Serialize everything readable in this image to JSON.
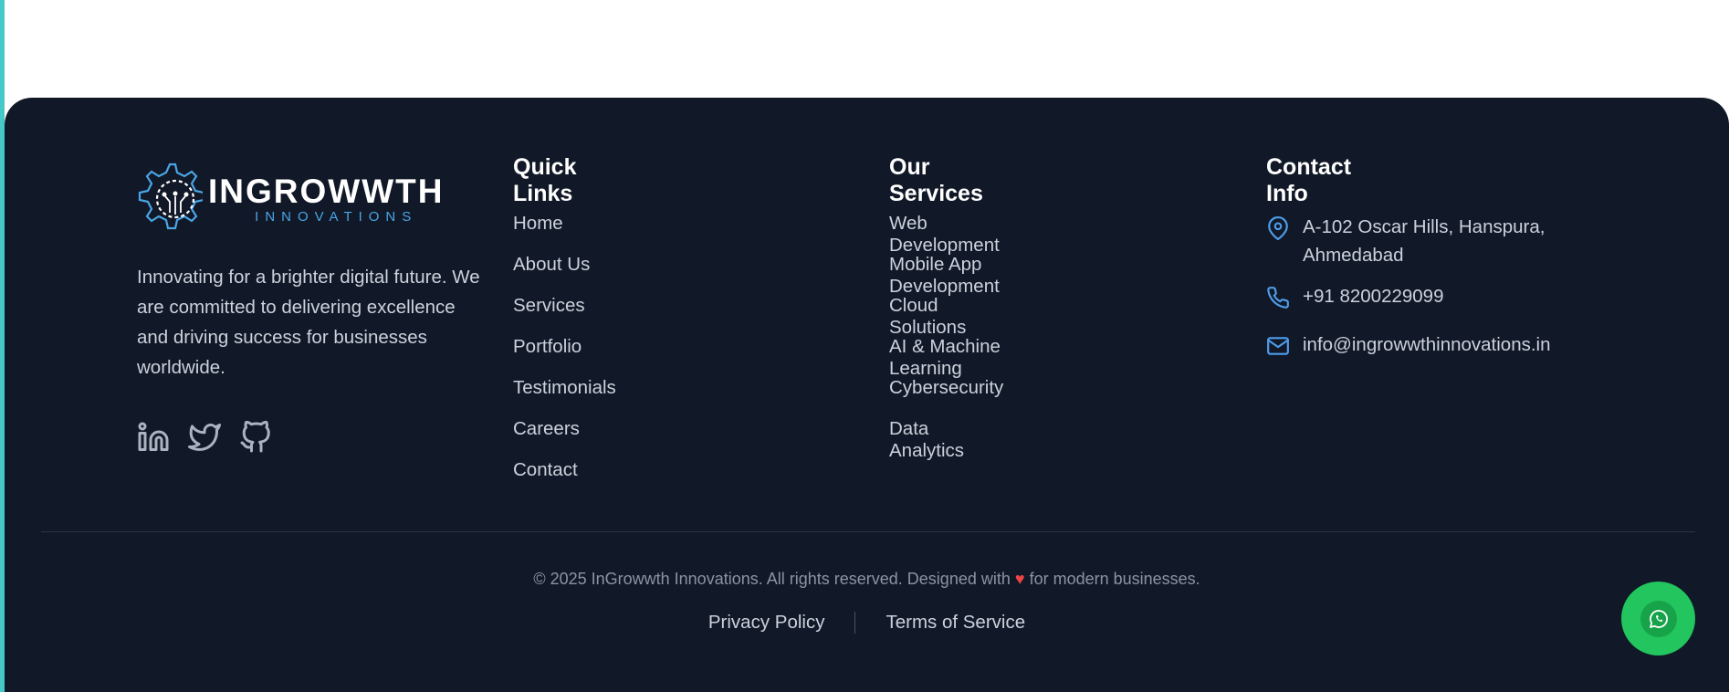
{
  "brand": {
    "logo_main": "INGROWWTH",
    "logo_sub": "INNOVATIONS",
    "tagline": "Innovating for a brighter digital future. We are committed to delivering excellence and driving success for businesses worldwide.",
    "social": [
      "linkedin-icon",
      "twitter-icon",
      "github-icon"
    ]
  },
  "quick_links": {
    "title": "Quick Links",
    "items": [
      "Home",
      "About Us",
      "Services",
      "Portfolio",
      "Testimonials",
      "Careers",
      "Contact"
    ]
  },
  "services": {
    "title": "Our Services",
    "items": [
      "Web Development",
      "Mobile App Development",
      "Cloud Solutions",
      "AI & Machine Learning",
      "Cybersecurity",
      "Data Analytics"
    ]
  },
  "contact": {
    "title": "Contact Info",
    "address": "A-102 Oscar Hills, Hanspura, Ahmedabad",
    "phone": "+91 8200229099",
    "email": "info@ingrowwthinnovations.in"
  },
  "bottom": {
    "copyright_prefix": "© 2025 InGrowwth Innovations. All rights reserved. Designed with",
    "heart": "♥",
    "copyright_suffix": "for modern businesses.",
    "privacy": "Privacy Policy",
    "terms": "Terms of Service"
  },
  "colors": {
    "footer_bg": "#111827",
    "accent_blue": "#4aa5e6",
    "whatsapp_green": "#22c55e",
    "heart_red": "#ef4444"
  }
}
